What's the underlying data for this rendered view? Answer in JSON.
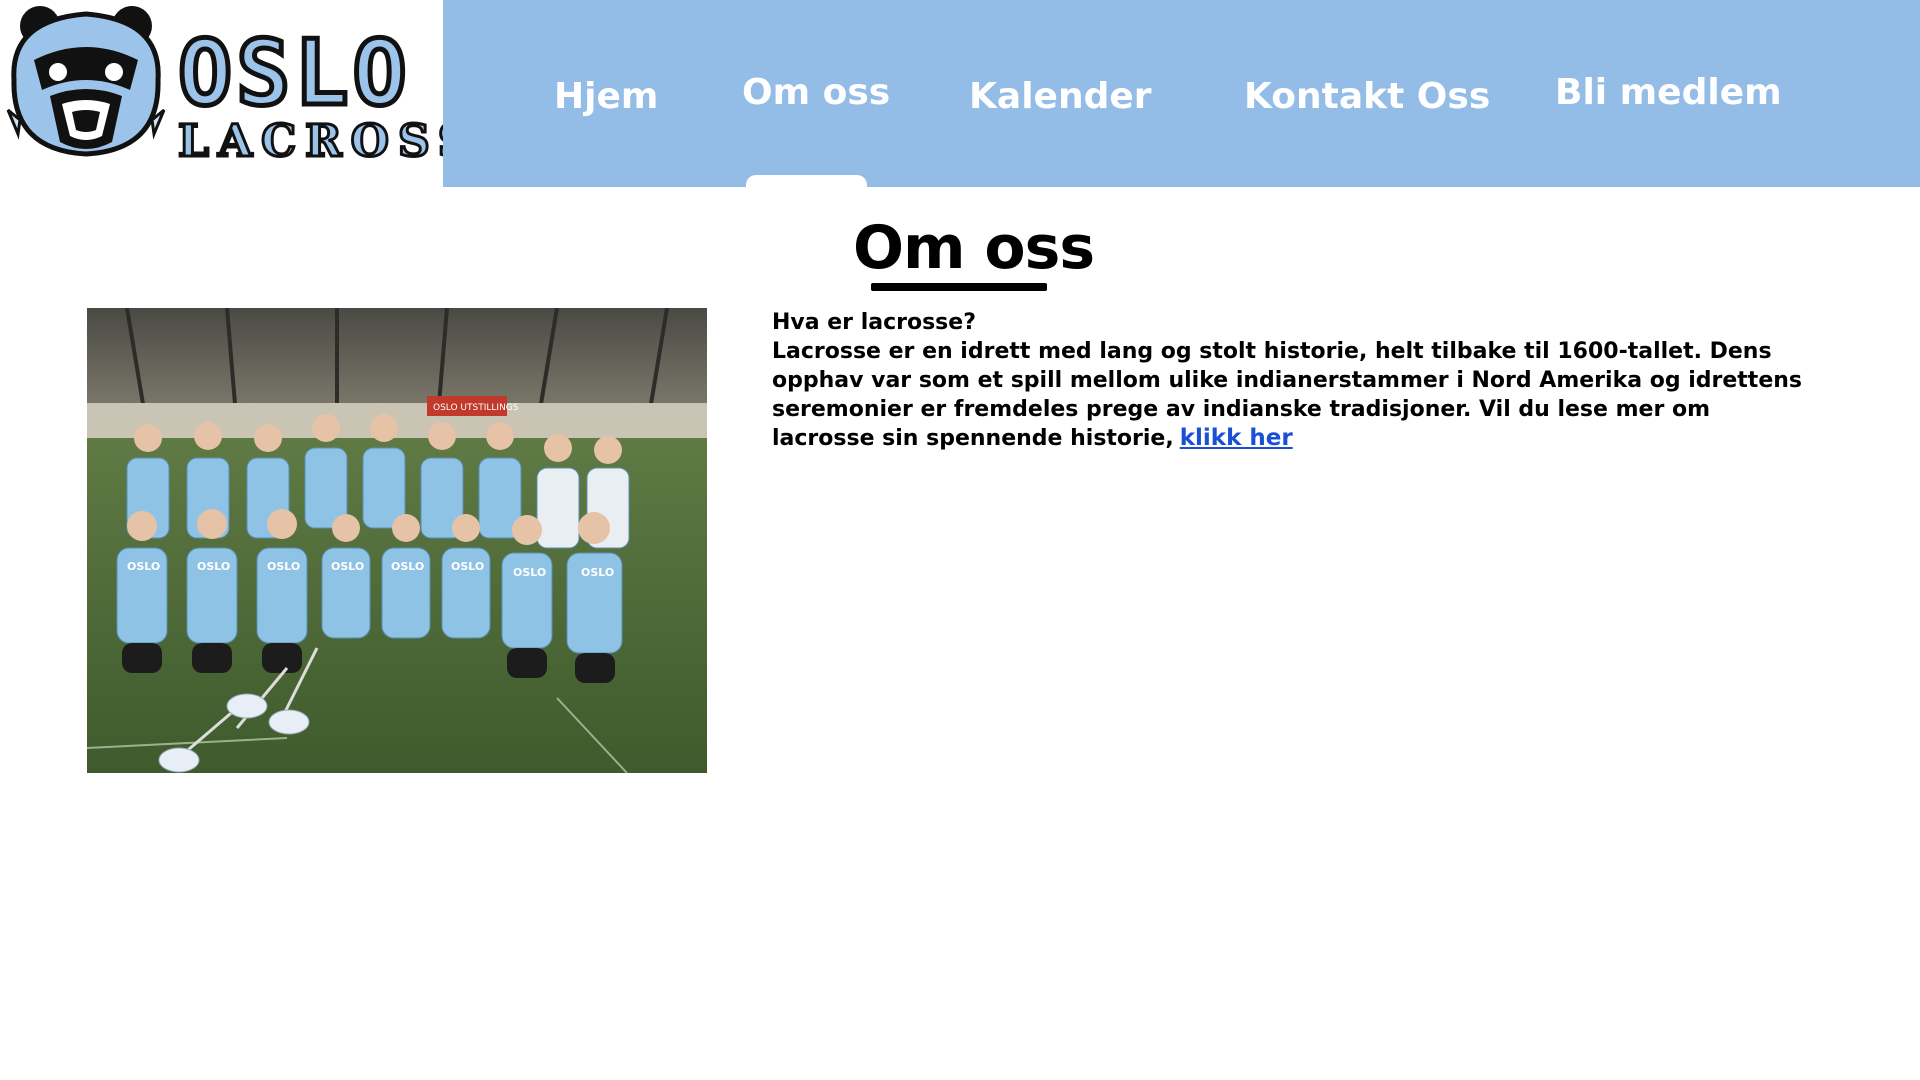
{
  "header": {
    "logo": {
      "word1": "OSLO",
      "word2": "LACROSSE",
      "icon": "panda-mascot-icon"
    },
    "nav": [
      {
        "label": "Hjem"
      },
      {
        "label": "Om oss",
        "active": true
      },
      {
        "label": "Kalender"
      },
      {
        "label": "Kontakt Oss"
      },
      {
        "label": "Bli medlem"
      }
    ],
    "nav_color": "#93bce6"
  },
  "main": {
    "title": "Om oss",
    "photo": {
      "jersey_text": "OSLO",
      "banner_text": "OSLO UTSTILLINGS"
    },
    "heading": "Hva er lacrosse?",
    "body": "Lacrosse er en idrett med lang og stolt historie, helt tilbake til 1600-tallet. Dens opphav var som et spill mellom ulike indianerstammer i Nord Amerika og idrettens seremonier er fremdeles prege av indianske tradisjoner. Vil du lese mer om lacrosse sin spennende historie,",
    "link_text": "klikk her",
    "link_color": "#1a4fd6"
  }
}
